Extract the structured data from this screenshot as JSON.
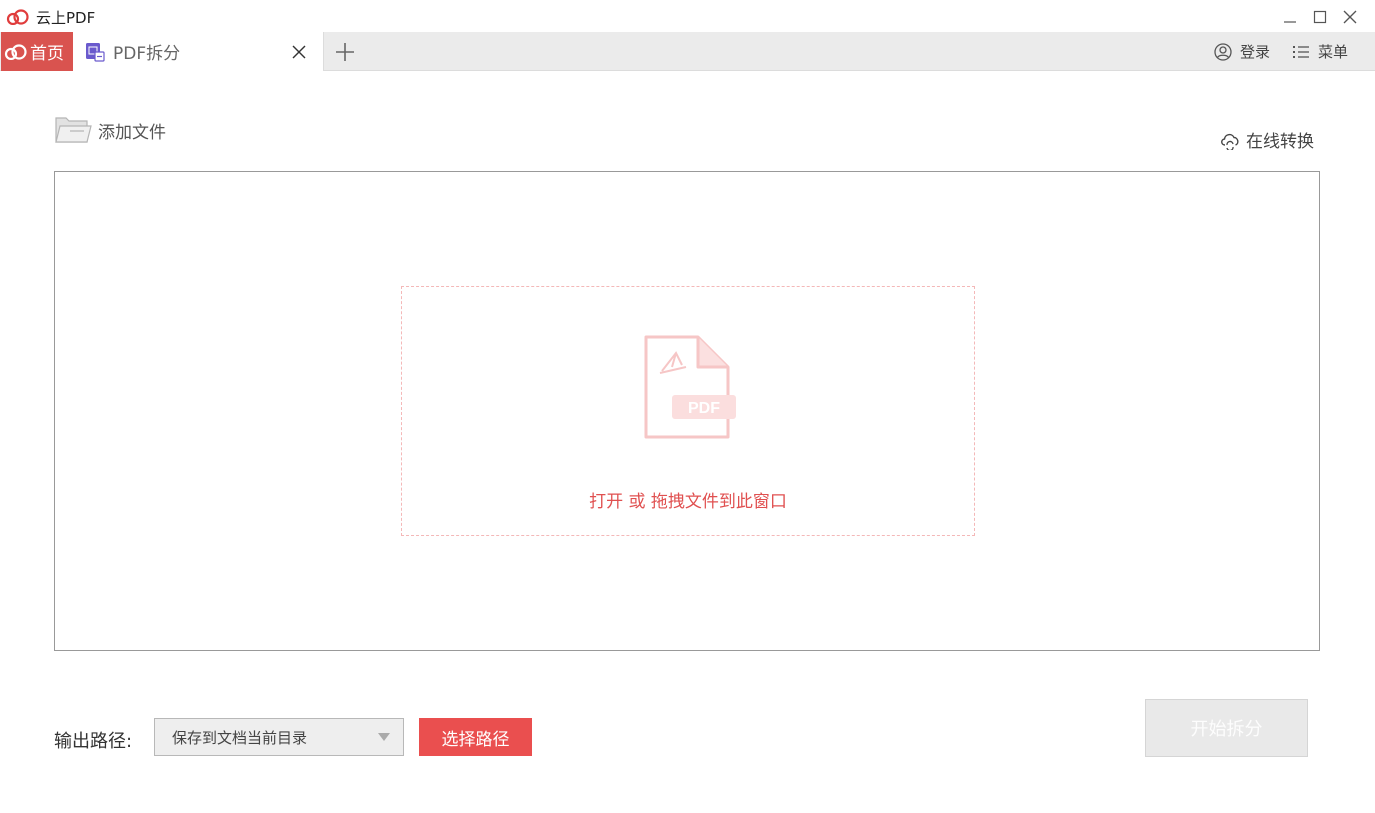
{
  "window": {
    "title": "云上PDF",
    "logo_icon": "cloud-logo-icon",
    "controls": [
      "minimize-icon",
      "maximize-icon",
      "close-icon"
    ]
  },
  "tabs": {
    "home_label": "首页",
    "active_tab_label": "PDF拆分",
    "add_icon": "plus-icon"
  },
  "header_actions": {
    "login_label": "登录",
    "menu_label": "菜单"
  },
  "toolbar": {
    "add_file_label": "添加文件",
    "online_convert_label": "在线转换"
  },
  "dropzone": {
    "badge_text": "PDF",
    "hint_text": "打开 或 拖拽文件到此窗口"
  },
  "output": {
    "label": "输出路径:",
    "selected_option": "保存到文档当前目录",
    "choose_button": "选择路径",
    "start_button": "开始拆分"
  },
  "colors": {
    "accent": "#d9534f",
    "button_red": "#ea4f4f",
    "hint_red": "#e05050"
  }
}
